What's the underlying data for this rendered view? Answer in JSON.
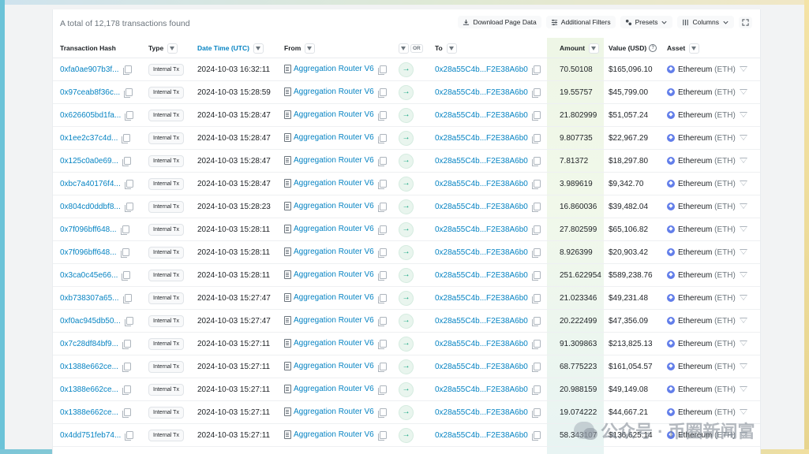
{
  "header": {
    "total_text": "A total of 12,178 transactions found",
    "download_label": "Download Page Data",
    "filters_label": "Additional Filters",
    "presets_label": "Presets",
    "columns_label": "Columns"
  },
  "columns": {
    "hash": "Transaction Hash",
    "type": "Type",
    "datetime": "Date Time (UTC)",
    "from": "From",
    "or": "OR",
    "to": "To",
    "amount": "Amount",
    "value": "Value (USD)",
    "asset": "Asset"
  },
  "rows": [
    {
      "hash": "0xfa0ae907b3f...",
      "type": "Internal Tx",
      "time": "2024-10-03 16:32:11",
      "from": "Aggregation Router V6",
      "to": "0x28a55C4b...F2E38A6b0",
      "amount": "70.50108",
      "value": "$165,096.10",
      "asset": "Ethereum",
      "symbol": "(ETH)"
    },
    {
      "hash": "0x97ceab8f36c...",
      "type": "Internal Tx",
      "time": "2024-10-03 15:28:59",
      "from": "Aggregation Router V6",
      "to": "0x28a55C4b...F2E38A6b0",
      "amount": "19.55757",
      "value": "$45,799.00",
      "asset": "Ethereum",
      "symbol": "(ETH)"
    },
    {
      "hash": "0x626605bd1fa...",
      "type": "Internal Tx",
      "time": "2024-10-03 15:28:47",
      "from": "Aggregation Router V6",
      "to": "0x28a55C4b...F2E38A6b0",
      "amount": "21.802999",
      "value": "$51,057.24",
      "asset": "Ethereum",
      "symbol": "(ETH)"
    },
    {
      "hash": "0x1ee2c37c4d...",
      "type": "Internal Tx",
      "time": "2024-10-03 15:28:47",
      "from": "Aggregation Router V6",
      "to": "0x28a55C4b...F2E38A6b0",
      "amount": "9.807735",
      "value": "$22,967.29",
      "asset": "Ethereum",
      "symbol": "(ETH)"
    },
    {
      "hash": "0x125c0a0e69...",
      "type": "Internal Tx",
      "time": "2024-10-03 15:28:47",
      "from": "Aggregation Router V6",
      "to": "0x28a55C4b...F2E38A6b0",
      "amount": "7.81372",
      "value": "$18,297.80",
      "asset": "Ethereum",
      "symbol": "(ETH)"
    },
    {
      "hash": "0xbc7a40176f4...",
      "type": "Internal Tx",
      "time": "2024-10-03 15:28:47",
      "from": "Aggregation Router V6",
      "to": "0x28a55C4b...F2E38A6b0",
      "amount": "3.989619",
      "value": "$9,342.70",
      "asset": "Ethereum",
      "symbol": "(ETH)"
    },
    {
      "hash": "0x804cd0ddbf8...",
      "type": "Internal Tx",
      "time": "2024-10-03 15:28:23",
      "from": "Aggregation Router V6",
      "to": "0x28a55C4b...F2E38A6b0",
      "amount": "16.860036",
      "value": "$39,482.04",
      "asset": "Ethereum",
      "symbol": "(ETH)"
    },
    {
      "hash": "0x7f096bff648...",
      "type": "Internal Tx",
      "time": "2024-10-03 15:28:11",
      "from": "Aggregation Router V6",
      "to": "0x28a55C4b...F2E38A6b0",
      "amount": "27.802599",
      "value": "$65,106.82",
      "asset": "Ethereum",
      "symbol": "(ETH)"
    },
    {
      "hash": "0x7f096bff648...",
      "type": "Internal Tx",
      "time": "2024-10-03 15:28:11",
      "from": "Aggregation Router V6",
      "to": "0x28a55C4b...F2E38A6b0",
      "amount": "8.926399",
      "value": "$20,903.42",
      "asset": "Ethereum",
      "symbol": "(ETH)"
    },
    {
      "hash": "0x3ca0c45e66...",
      "type": "Internal Tx",
      "time": "2024-10-03 15:28:11",
      "from": "Aggregation Router V6",
      "to": "0x28a55C4b...F2E38A6b0",
      "amount": "251.622954",
      "value": "$589,238.76",
      "asset": "Ethereum",
      "symbol": "(ETH)"
    },
    {
      "hash": "0xb738307a65...",
      "type": "Internal Tx",
      "time": "2024-10-03 15:27:47",
      "from": "Aggregation Router V6",
      "to": "0x28a55C4b...F2E38A6b0",
      "amount": "21.023346",
      "value": "$49,231.48",
      "asset": "Ethereum",
      "symbol": "(ETH)"
    },
    {
      "hash": "0xf0ac945db50...",
      "type": "Internal Tx",
      "time": "2024-10-03 15:27:47",
      "from": "Aggregation Router V6",
      "to": "0x28a55C4b...F2E38A6b0",
      "amount": "20.222499",
      "value": "$47,356.09",
      "asset": "Ethereum",
      "symbol": "(ETH)"
    },
    {
      "hash": "0x7c28df84bf9...",
      "type": "Internal Tx",
      "time": "2024-10-03 15:27:11",
      "from": "Aggregation Router V6",
      "to": "0x28a55C4b...F2E38A6b0",
      "amount": "91.309863",
      "value": "$213,825.13",
      "asset": "Ethereum",
      "symbol": "(ETH)"
    },
    {
      "hash": "0x1388e662ce...",
      "type": "Internal Tx",
      "time": "2024-10-03 15:27:11",
      "from": "Aggregation Router V6",
      "to": "0x28a55C4b...F2E38A6b0",
      "amount": "68.775223",
      "value": "$161,054.57",
      "asset": "Ethereum",
      "symbol": "(ETH)"
    },
    {
      "hash": "0x1388e662ce...",
      "type": "Internal Tx",
      "time": "2024-10-03 15:27:11",
      "from": "Aggregation Router V6",
      "to": "0x28a55C4b...F2E38A6b0",
      "amount": "20.988159",
      "value": "$49,149.08",
      "asset": "Ethereum",
      "symbol": "(ETH)"
    },
    {
      "hash": "0x1388e662ce...",
      "type": "Internal Tx",
      "time": "2024-10-03 15:27:11",
      "from": "Aggregation Router V6",
      "to": "0x28a55C4b...F2E38A6b0",
      "amount": "19.074222",
      "value": "$44,667.21",
      "asset": "Ethereum",
      "symbol": "(ETH)"
    },
    {
      "hash": "0x4dd751feb74...",
      "type": "Internal Tx",
      "time": "2024-10-03 15:27:11",
      "from": "Aggregation Router V6",
      "to": "0x28a55C4b...F2E38A6b0",
      "amount": "58.343107",
      "value": "$136,625.14",
      "asset": "Ethereum",
      "symbol": "(ETH)"
    }
  ],
  "watermark": "公众号 · 币圈新闻富",
  "colors": {
    "link": "#0784c3",
    "amount_bg": "#eef6e6",
    "eth": "#627eea"
  }
}
